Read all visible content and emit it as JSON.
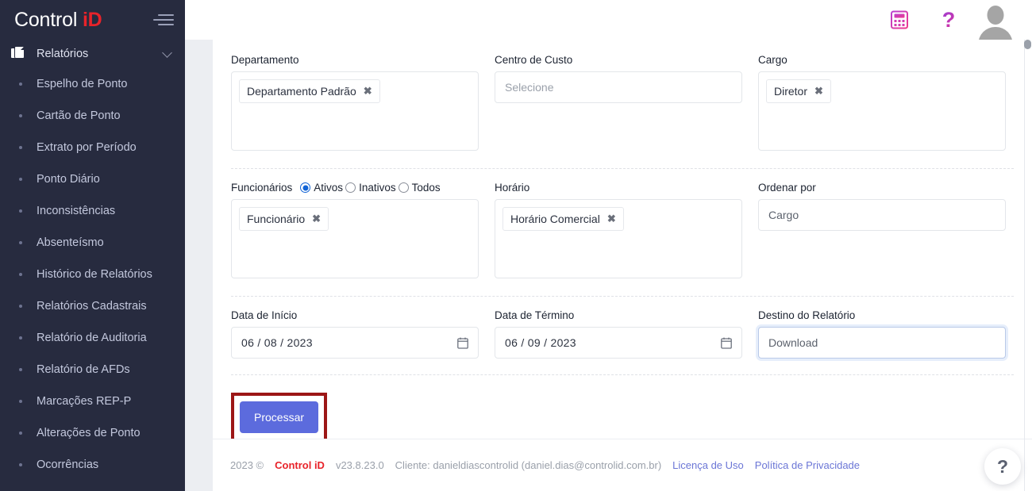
{
  "sidebar": {
    "brand": {
      "part1": "Control ",
      "part2": "iD"
    },
    "group": {
      "label": "Relatórios",
      "icon": "reports-icon",
      "chevron": "chevron-down-icon"
    },
    "items": [
      {
        "label": "Espelho de Ponto"
      },
      {
        "label": "Cartão de Ponto"
      },
      {
        "label": "Extrato por Período"
      },
      {
        "label": "Ponto Diário"
      },
      {
        "label": "Inconsistências"
      },
      {
        "label": "Absenteísmo"
      },
      {
        "label": "Histórico de Relatórios"
      },
      {
        "label": "Relatórios Cadastrais"
      },
      {
        "label": "Relatório de Auditoria"
      },
      {
        "label": "Relatório de AFDs"
      },
      {
        "label": "Marcações REP-P"
      },
      {
        "label": "Alterações de Ponto"
      },
      {
        "label": "Ocorrências"
      }
    ]
  },
  "topbar": {
    "calculator_icon": "calculator-icon",
    "help_icon": "question-mark-icon",
    "avatar_icon": "user-avatar-icon"
  },
  "form": {
    "departamento": {
      "label": "Departamento",
      "chips": [
        {
          "label": "Departamento Padrão",
          "remove": "✖"
        }
      ]
    },
    "centro_de_custo": {
      "label": "Centro de Custo",
      "placeholder": "Selecione"
    },
    "cargo": {
      "label": "Cargo",
      "chips": [
        {
          "label": "Diretor",
          "remove": "✖"
        }
      ]
    },
    "funcionarios": {
      "label": "Funcionários",
      "options": [
        {
          "label": "Ativos",
          "selected": true
        },
        {
          "label": "Inativos",
          "selected": false
        },
        {
          "label": "Todos",
          "selected": false
        }
      ],
      "chips": [
        {
          "label": "Funcionário",
          "remove": "✖"
        }
      ]
    },
    "horario": {
      "label": "Horário",
      "chips": [
        {
          "label": "Horário Comercial",
          "remove": "✖"
        }
      ]
    },
    "ordenar_por": {
      "label": "Ordenar por",
      "value": "Cargo"
    },
    "data_inicio": {
      "label": "Data de Início",
      "value": "06 / 08 / 2023",
      "icon": "calendar-icon"
    },
    "data_termino": {
      "label": "Data de Término",
      "value": "06 / 09 / 2023",
      "icon": "calendar-icon"
    },
    "destino": {
      "label": "Destino do Relatório",
      "value": "Download"
    },
    "submit": {
      "label": "Processar"
    }
  },
  "footer": {
    "copyright": "2023 ©",
    "brand": "Control iD",
    "version": "v23.8.23.0",
    "client": "Cliente: danieldiascontrolid (daniel.dias@controlid.com.br)",
    "link_license": "Licença de Uso",
    "link_privacy": "Política de Privacidade"
  },
  "help_fab": {
    "label": "?"
  },
  "colors": {
    "sidebar_bg": "#272b3f",
    "brand_red": "#e8232a",
    "primary_button": "#5c6bdd",
    "annotation_red": "#9c1616",
    "radio_blue": "#1264d6",
    "page_bg": "#eceef2"
  }
}
